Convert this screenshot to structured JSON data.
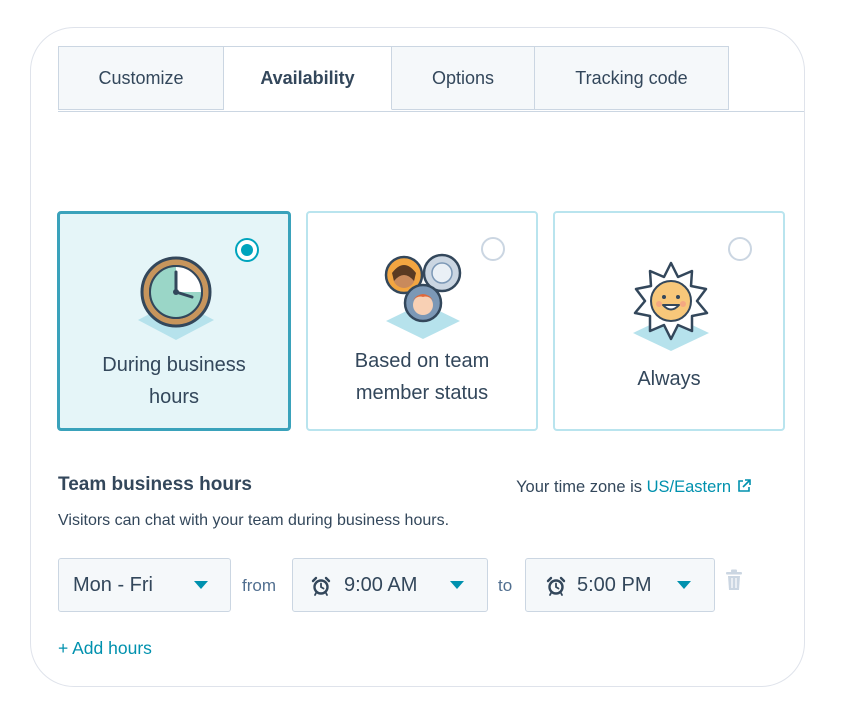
{
  "tabs": [
    {
      "label": "Customize",
      "active": false
    },
    {
      "label": "Availability",
      "active": true
    },
    {
      "label": "Options",
      "active": false
    },
    {
      "label": "Tracking code",
      "active": false
    }
  ],
  "availability": {
    "options": [
      {
        "label_line1": "During business",
        "label_line2": "hours",
        "selected": true,
        "icon": "clock-icon"
      },
      {
        "label_line1": "Based on team",
        "label_line2": "member status",
        "selected": false,
        "icon": "team-avatars-icon"
      },
      {
        "label_line1": "Always",
        "label_line2": "",
        "selected": false,
        "icon": "sun-icon"
      }
    ]
  },
  "business_hours": {
    "title": "Team business hours",
    "timezone_prefix": "Your time zone is",
    "timezone_link": "US/Eastern",
    "description": "Visitors can chat with your team during business hours.",
    "days_value": "Mon - Fri",
    "from_label": "from",
    "start_time": "9:00 AM",
    "to_label": "to",
    "end_time": "5:00 PM",
    "add_hours_label": "+ Add hours"
  },
  "colors": {
    "accent": "#00a4bd",
    "link": "#0091ae",
    "selected_bg": "#e5f5f8",
    "text": "#33475b"
  }
}
